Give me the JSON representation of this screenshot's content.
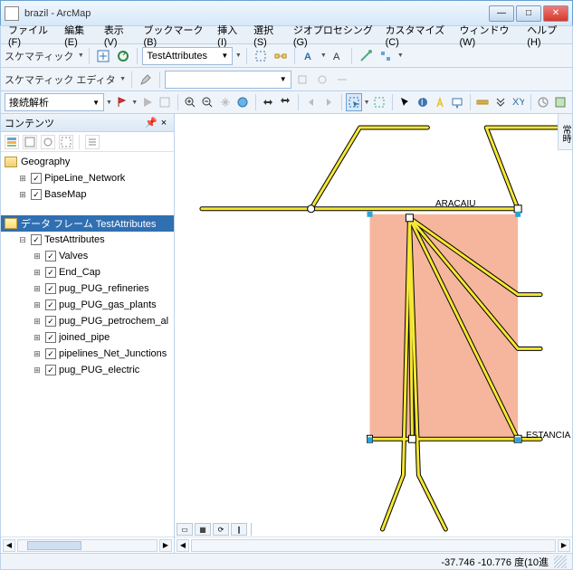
{
  "window": {
    "title": "brazil - ArcMap"
  },
  "menu": {
    "file": "ファイル(F)",
    "edit": "編集(E)",
    "view": "表示(V)",
    "bookmarks": "ブックマーク(B)",
    "insert": "挿入(I)",
    "select": "選択(S)",
    "geoproc": "ジオプロセシング(G)",
    "customize": "カスタマイズ(C)",
    "window": "ウィンドウ(W)",
    "help": "ヘルプ(H)"
  },
  "toolbar1": {
    "label": "スケマティック",
    "layer_select": "TestAttributes"
  },
  "toolbar2": {
    "label": "スケマティック エディタ",
    "select_empty": ""
  },
  "toolbar3": {
    "select": "接続解析"
  },
  "toc": {
    "title": "コンテンツ",
    "df1": "Geography",
    "items1": [
      "PipeLine_Network",
      "BaseMap"
    ],
    "df2": "データ フレーム TestAttributes",
    "df2_layer": "TestAttributes",
    "items2": [
      "Valves",
      "End_Cap",
      "pug_PUG_refineries",
      "pug_PUG_gas_plants",
      "pug_PUG_petrochem_al",
      "joined_pipe",
      "pipelines_Net_Junctions",
      "pug_PUG_electric"
    ]
  },
  "map": {
    "label_top": "ARACAIU",
    "label_bottom": "ESTANCIA",
    "rightstrip": "常時"
  },
  "status": {
    "coords": "-37.746  -10.776 度(10進"
  }
}
